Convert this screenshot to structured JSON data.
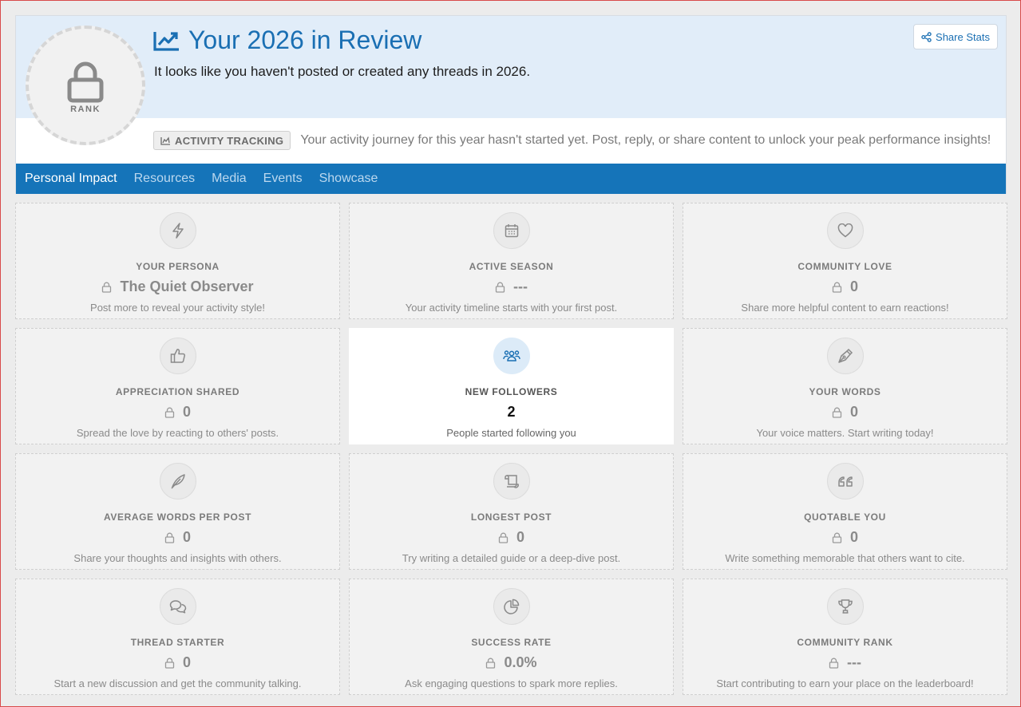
{
  "header": {
    "rank_label": "RANK",
    "title": "Your 2026 in Review",
    "subtitle": "It looks like you haven't posted or created any threads in 2026.",
    "share_label": "Share Stats",
    "tracking_badge": "ACTIVITY TRACKING",
    "tracking_text": "Your activity journey for this year hasn't started yet. Post, reply, or share content to unlock your peak performance insights!"
  },
  "tabs": [
    {
      "label": "Personal Impact",
      "active": true
    },
    {
      "label": "Resources",
      "active": false
    },
    {
      "label": "Media",
      "active": false
    },
    {
      "label": "Events",
      "active": false
    },
    {
      "label": "Showcase",
      "active": false
    }
  ],
  "cards": [
    {
      "icon": "bolt-icon",
      "label": "YOUR PERSONA",
      "value": "The Quiet Observer",
      "desc": "Post more to reveal your activity style!",
      "locked": true
    },
    {
      "icon": "calendar-icon",
      "label": "ACTIVE SEASON",
      "value": "---",
      "desc": "Your activity timeline starts with your first post.",
      "locked": true
    },
    {
      "icon": "heart-icon",
      "label": "COMMUNITY LOVE",
      "value": "0",
      "desc": "Share more helpful content to earn reactions!",
      "locked": true
    },
    {
      "icon": "thumbs-up-icon",
      "label": "APPRECIATION SHARED",
      "value": "0",
      "desc": "Spread the love by reacting to others' posts.",
      "locked": true
    },
    {
      "icon": "users-icon",
      "label": "NEW FOLLOWERS",
      "value": "2",
      "desc": "People started following you",
      "locked": false
    },
    {
      "icon": "pen-nib-icon",
      "label": "YOUR WORDS",
      "value": "0",
      "desc": "Your voice matters. Start writing today!",
      "locked": true
    },
    {
      "icon": "feather-icon",
      "label": "AVERAGE WORDS PER POST",
      "value": "0",
      "desc": "Share your thoughts and insights with others.",
      "locked": true
    },
    {
      "icon": "scroll-icon",
      "label": "LONGEST POST",
      "value": "0",
      "desc": "Try writing a detailed guide or a deep-dive post.",
      "locked": true
    },
    {
      "icon": "quote-icon",
      "label": "QUOTABLE YOU",
      "value": "0",
      "desc": "Write something memorable that others want to cite.",
      "locked": true
    },
    {
      "icon": "comments-icon",
      "label": "THREAD STARTER",
      "value": "0",
      "desc": "Start a new discussion and get the community talking.",
      "locked": true
    },
    {
      "icon": "pie-chart-icon",
      "label": "SUCCESS RATE",
      "value": "0.0%",
      "desc": "Ask engaging questions to spark more replies.",
      "locked": true
    },
    {
      "icon": "trophy-icon",
      "label": "COMMUNITY RANK",
      "value": "---",
      "desc": "Start contributing to earn your place on the leaderboard!",
      "locked": true
    }
  ],
  "colors": {
    "accent": "#1574b9",
    "title_blue": "#1a6fb3",
    "hero_bg": "#e1edf9",
    "card_bg": "#f2f2f2"
  }
}
